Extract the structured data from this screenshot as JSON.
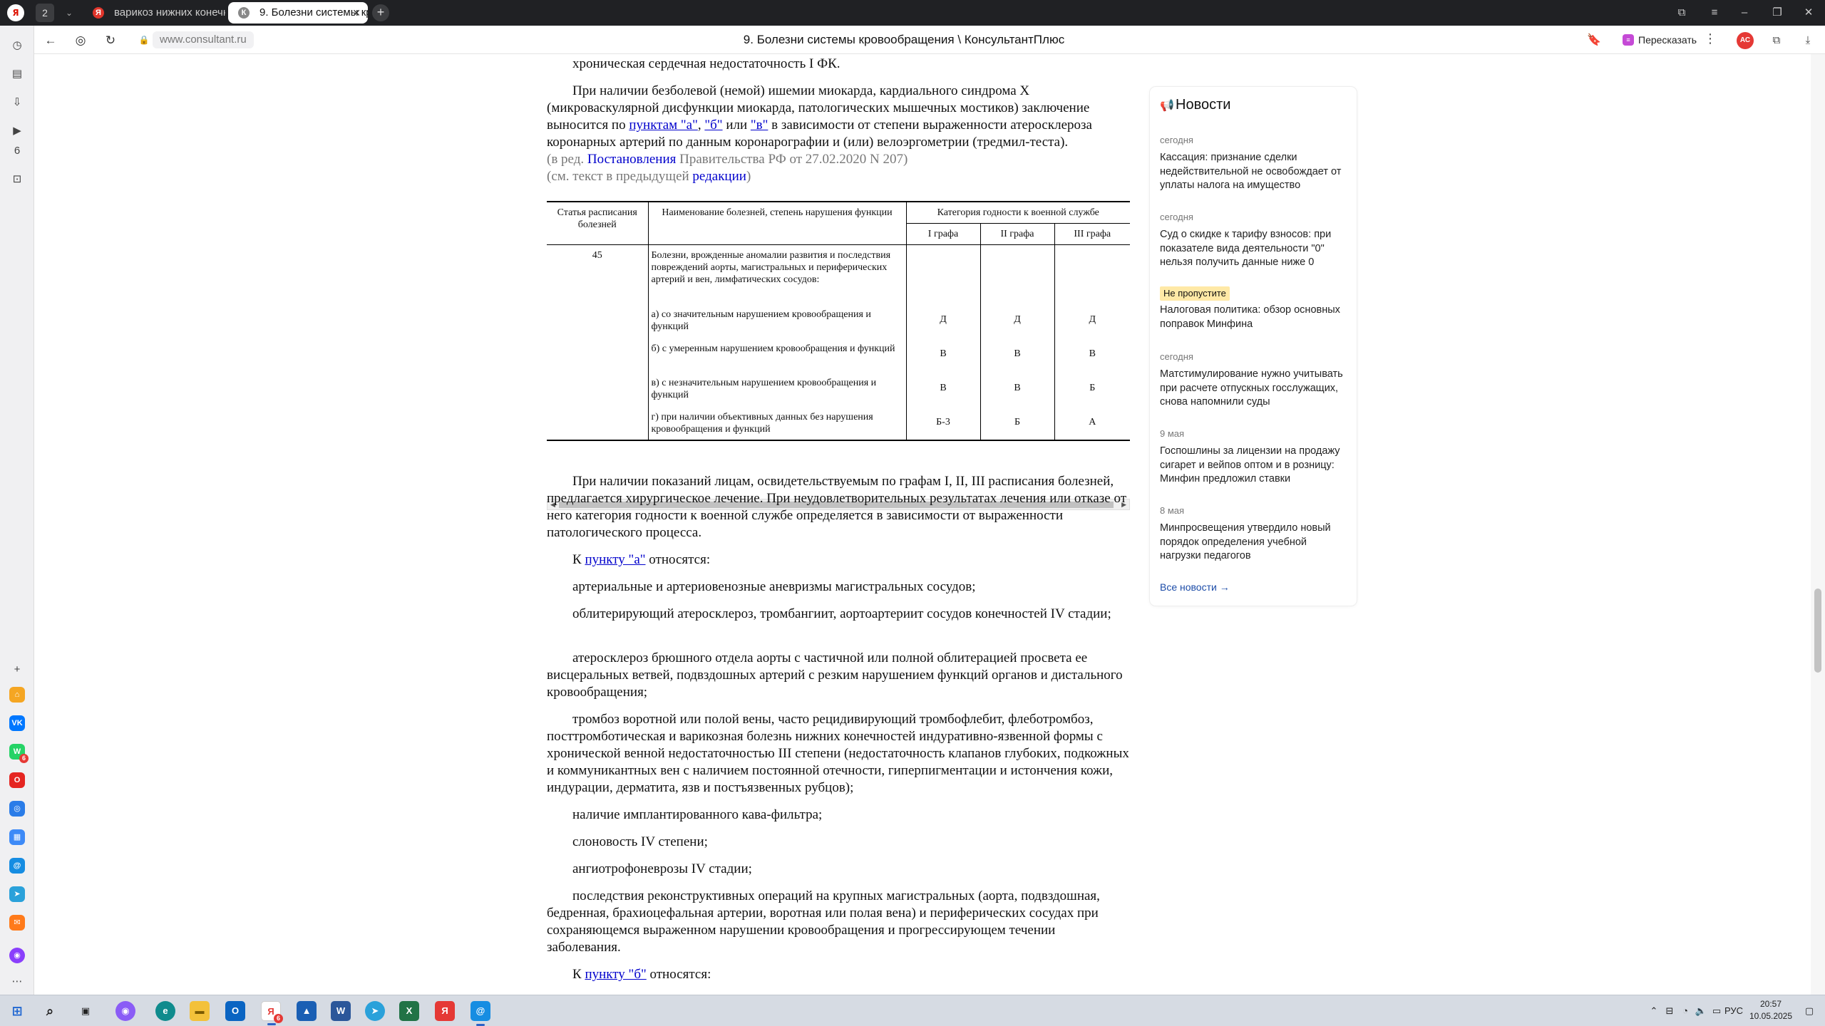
{
  "browser": {
    "tab_count": "2",
    "tabs": [
      {
        "label": "варикоз нижних конечнос",
        "favicon": "Я"
      },
      {
        "label": "9. Болезни системы кро",
        "favicon": "К"
      }
    ],
    "url": "www.consultant.ru",
    "page_title": "9. Болезни системы кровообращения \\ КонсультантПлюс",
    "retell_label": "Пересказать",
    "profile_initials": "АС"
  },
  "sidebar": {
    "apps": [
      {
        "name": "yandex-disk",
        "color": "#f5a623"
      },
      {
        "name": "vk",
        "color": "#0077ff",
        "glyph": "VK"
      },
      {
        "name": "whatsapp",
        "color": "#25d366",
        "glyph": "W",
        "badge": "6"
      },
      {
        "name": "opera",
        "color": "#e52521",
        "glyph": "O"
      },
      {
        "name": "app-blue",
        "color": "#2a7ce8",
        "glyph": "◎"
      },
      {
        "name": "apps-grid",
        "color": "#3d8af7",
        "glyph": "▦"
      },
      {
        "name": "mail-ru",
        "color": "#168de2",
        "glyph": "@"
      },
      {
        "name": "telegram",
        "color": "#2aa1da",
        "glyph": "➤"
      },
      {
        "name": "mail-orange",
        "color": "#ff7a1a",
        "glyph": "✉"
      },
      {
        "name": "alice",
        "color": "#8a3ffc",
        "glyph": "◉"
      }
    ]
  },
  "doc": {
    "line_top": "хроническая сердечная недостаточность I ФК.",
    "para1_a": "При наличии безболевой (немой) ишемии миокарда, кардиального синдрома X (микроваскулярной дисфункции миокарда, патологических мышечных мостиков) заключение выносится по ",
    "para1_link1": "пунктам \"а\"",
    "para1_sep1": ", ",
    "para1_link2": "\"б\"",
    "para1_or": " или ",
    "para1_link3": "\"в\"",
    "para1_b": " в зависимости от степени выраженности атеросклероза коронарных артерий по данным коронарографии и (или) велоэргометрии (тредмил-теста).",
    "red_prefix": "(в ред. ",
    "red_link": "Постановления",
    "red_suffix": " Правительства РФ от 27.02.2020 N 207)",
    "prev_prefix": "(см. текст в предыдущей ",
    "prev_link": "редакции",
    "prev_suffix": ")",
    "table": {
      "h_article": "Статья расписания болезней",
      "h_name": "Наименование болезней, степень нарушения функции",
      "h_category": "Категория годности к военной службе",
      "h_cols": [
        "I графа",
        "II графа",
        "III графа"
      ],
      "article": "45",
      "row0_name": "Болезни, врожденные аномалии развития и последствия повреждений аорты, магистральных и периферических артерий и вен, лимфатических сосудов:",
      "rows": [
        {
          "name": "а) со значительным нарушением кровообращения и функций",
          "v": [
            "Д",
            "Д",
            "Д"
          ]
        },
        {
          "name": "б) с умеренным нарушением кровообращения и функций",
          "v": [
            "В",
            "В",
            "В"
          ]
        },
        {
          "name": "в) с незначительным нарушением кровообращения и функций",
          "v": [
            "В",
            "В",
            "Б"
          ]
        },
        {
          "name": "г) при наличии объективных данных без нарушения кровообращения и функций",
          "v": [
            "Б-3",
            "Б",
            "А"
          ]
        }
      ]
    },
    "para2": "При наличии показаний лицам, освидетельствуемым по графам I, II, III расписания болезней, предлагается хирургическое лечение. При неудовлетворительных результатах лечения или отказе от него категория годности к военной службе определяется в зависимости от выраженности патологического процесса.",
    "ka_prefix": "К ",
    "ka_link": "пункту \"а\"",
    "ka_suffix": " относятся:",
    "items": [
      "артериальные и артериовенозные аневризмы магистральных сосудов;",
      "облитерирующий атеросклероз, тромбангиит, аортоартериит сосудов конечностей IV стадии;",
      "атеросклероз брюшного отдела аорты с частичной или полной облитерацией просвета ее висцеральных ветвей, подвздошных артерий с резким нарушением функций органов и дистального кровообращения;",
      "тромбоз воротной или полой вены, часто рецидивирующий тромбофлебит, флеботромбоз, посттромботическая и варикозная болезнь нижних конечностей индуративно-язвенной формы с хронической венной недостаточностью III степени (недостаточность клапанов глубоких, подкожных и коммуникантных вен с наличием постоянной отечности, гиперпигментации и истончения кожи, индурации, дерматита, язв и постъязвенных рубцов);",
      "наличие имплантированного кава-фильтра;",
      "слоновость IV степени;",
      "ангиотрофоневрозы IV стадии;",
      "последствия реконструктивных операций на крупных магистральных (аорта, подвздошная, бедренная, брахиоцефальная артерии, воротная или полая вена) и периферических сосудах при сохраняющемся выраженном нарушении кровообращения и прогрессирующем течении заболевания."
    ],
    "kb_prefix": "К ",
    "kb_link": "пункту \"б\"",
    "kb_suffix": " относятся:"
  },
  "news": {
    "title": "Новости",
    "items": [
      {
        "date": "сегодня",
        "text": "Кассация: признание сделки недействительной не освобождает от уплаты налога на имущество"
      },
      {
        "date": "сегодня",
        "text": "Суд о скидке к тарифу взносов: при показателе вида деятельности \"0\" нельзя получить данные ниже 0"
      },
      {
        "badge": "Не пропустите",
        "text": "Налоговая политика: обзор основных поправок Минфина"
      },
      {
        "date": "сегодня",
        "text": "Матстимулирование нужно учитывать при расчете отпускных госслужащих, снова напомнили суды"
      },
      {
        "date": "9 мая",
        "text": "Госпошлины за лицензии на продажу сигарет и вейпов оптом и в розницу: Минфин предложил ставки"
      },
      {
        "date": "8 мая",
        "text": "Минпросвещения утвердило новый порядок определения учебной нагрузки педагогов"
      }
    ],
    "all_link": "Все новости →"
  },
  "taskbar": {
    "lang": "РУС",
    "time": "20:57",
    "date": "10.05.2025",
    "yandex_badge": "6"
  },
  "colors": {
    "link": "#0000cc",
    "news_link": "#1c4ca8",
    "badge_bg": "#ffe9a6",
    "tabbar_bg": "#202124",
    "taskbar_bg": "#d6dbe3"
  }
}
